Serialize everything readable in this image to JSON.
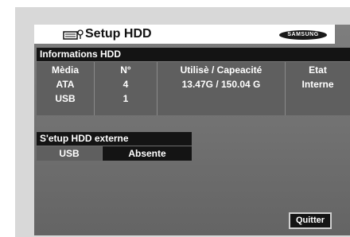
{
  "title": {
    "icon": "hdd-icon",
    "text": "Setup HDD",
    "brand": "SAMSUNG"
  },
  "info": {
    "heading": "Informations HDD",
    "columns": [
      {
        "header": "Mèdia",
        "cells": [
          "ATA",
          "USB"
        ]
      },
      {
        "header": "N°",
        "cells": [
          "4",
          "1"
        ]
      },
      {
        "header": "Utilisè / Capeacité",
        "cells": [
          "13.47G / 150.04 G",
          ""
        ]
      },
      {
        "header": "Etat",
        "cells": [
          "Interne",
          ""
        ]
      }
    ]
  },
  "external": {
    "heading": "S'etup HDD externe",
    "label": "USB",
    "value": "Absente"
  },
  "buttons": {
    "quit": "Quitter"
  },
  "colors": {
    "panel": "#646464",
    "header": "#141414",
    "frame": "#d8d8d8"
  }
}
